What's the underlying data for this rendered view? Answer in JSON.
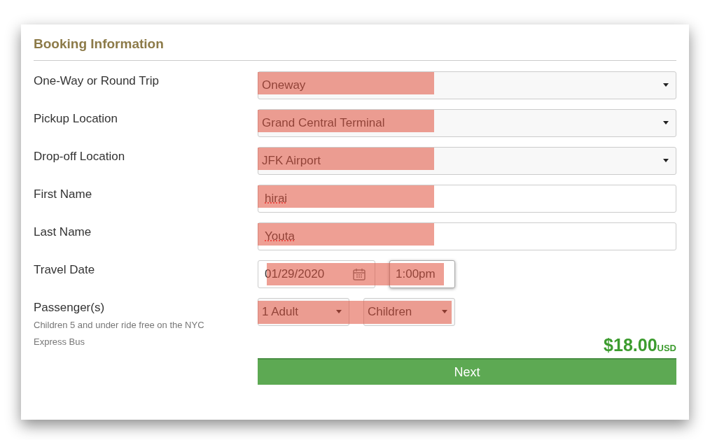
{
  "form": {
    "title": "Booking Information",
    "rows": [
      {
        "label": "One-Way or Round Trip",
        "kind": "select",
        "value": "Oneway",
        "highlighted": true
      },
      {
        "label": "Pickup Location",
        "kind": "select",
        "value": "Grand Central Terminal",
        "highlighted": true
      },
      {
        "label": "Drop-off Location",
        "kind": "select",
        "value": "JFK Airport",
        "highlighted": true
      },
      {
        "label": "First Name",
        "kind": "text",
        "value": "hirai",
        "spellcheck_flagged": true,
        "highlighted": true
      },
      {
        "label": "Last Name",
        "kind": "text",
        "value": "Youta",
        "spellcheck_flagged": true,
        "highlighted": true
      },
      {
        "label": "Travel Date",
        "kind": "datetime",
        "date": "01/29/2020",
        "time": "1:00pm",
        "highlighted": true
      },
      {
        "label": "Passenger(s)",
        "kind": "passengers",
        "note": "Children 5 and under ride free on the NYC Express Bus",
        "adults": "1 Adult",
        "children": "Children",
        "highlighted": true
      }
    ],
    "price": {
      "amount": "$18.00",
      "currency": "USD"
    },
    "next_button": "Next"
  }
}
